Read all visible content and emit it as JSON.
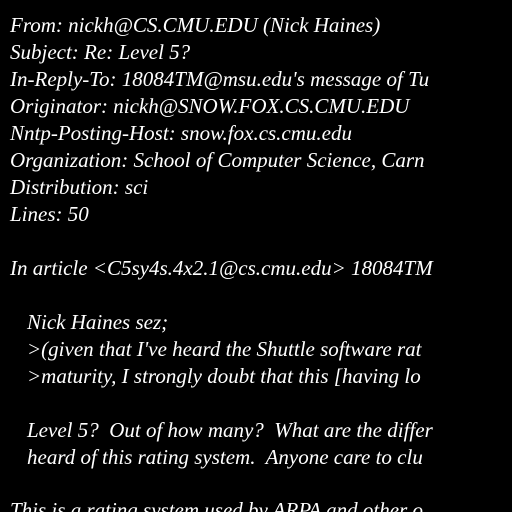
{
  "colors": {
    "background": "#000000",
    "text": "#ffffff"
  },
  "headers": {
    "from": "From: nickh@CS.CMU.EDU (Nick Haines)",
    "subject": "Subject: Re: Level 5?",
    "in_reply_to": "In-Reply-To: 18084TM@msu.edu's message of Tu",
    "originator": "Originator: nickh@SNOW.FOX.CS.CMU.EDU",
    "nntp_posting_host": "Nntp-Posting-Host: snow.fox.cs.cmu.edu",
    "organization": "Organization: School of Computer Science, Carn",
    "distribution": "Distribution: sci",
    "lines": "Lines: 50"
  },
  "body": {
    "attribution": "In article <C5sy4s.4x2.1@cs.cmu.edu> 18084TM",
    "quote_author": "Nick Haines sez;",
    "quote_line_1": ">(given that I've heard the Shuttle software rat",
    "quote_line_2": ">maturity, I strongly doubt that this [having lo",
    "reply_line_1": "Level 5?  Out of how many?  What are the differ",
    "reply_line_2": "heard of this rating system.  Anyone care to clu",
    "response_line_1": "This is a rating system used by ARPA and other o"
  }
}
